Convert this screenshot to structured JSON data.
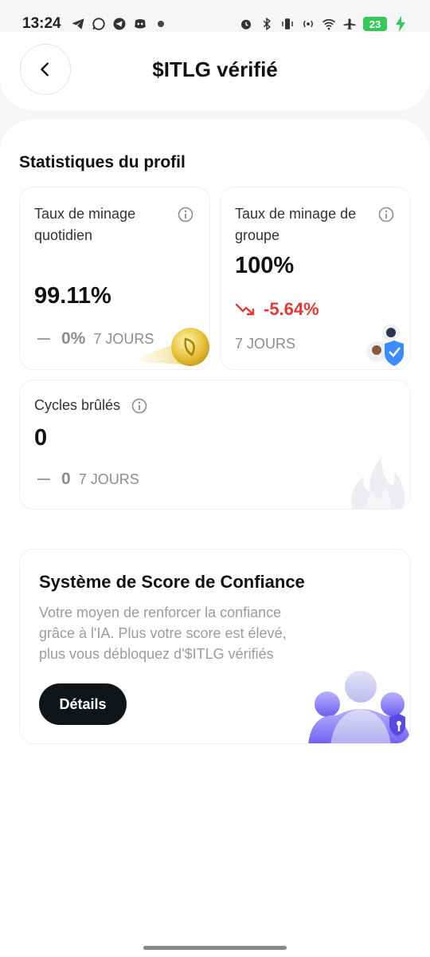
{
  "status_bar": {
    "time": "13:24",
    "battery": "23",
    "left_icons": [
      "telegram-icon",
      "whatsapp-icon",
      "telegram-icon",
      "discord-icon",
      "dot-icon"
    ],
    "right_icons": [
      "alarm-icon",
      "bluetooth-icon",
      "vibrate-icon",
      "hotspot-icon",
      "wifi-icon",
      "airplane-icon",
      "battery-icon",
      "charging-icon"
    ]
  },
  "header": {
    "title": "$ITLG vérifié",
    "back_icon": "chevron-left-icon"
  },
  "section": {
    "title": "Statistiques du profil"
  },
  "cards": {
    "daily": {
      "label": "Taux de minage quotidien",
      "value": "99.11%",
      "change": "0%",
      "period": "7 JOURS"
    },
    "group": {
      "label": "Taux de minage de groupe",
      "value": "100%",
      "change": "-5.64%",
      "period": "7 JOURS"
    },
    "burned": {
      "label": "Cycles brûlés",
      "value": "0",
      "change": "0",
      "period": "7 JOURS"
    }
  },
  "trust": {
    "title": "Système de Score de Confiance",
    "description": "Votre moyen de renforcer la confiance grâce à l'IA. Plus votre score est élevé, plus vous débloquez d'$ITLG vérifiés",
    "button": "Détails"
  },
  "colors": {
    "accent_negative": "#e53935",
    "button_dark": "#111418",
    "battery_green": "#34c759",
    "illustration_purple": "#7b6cf0"
  }
}
